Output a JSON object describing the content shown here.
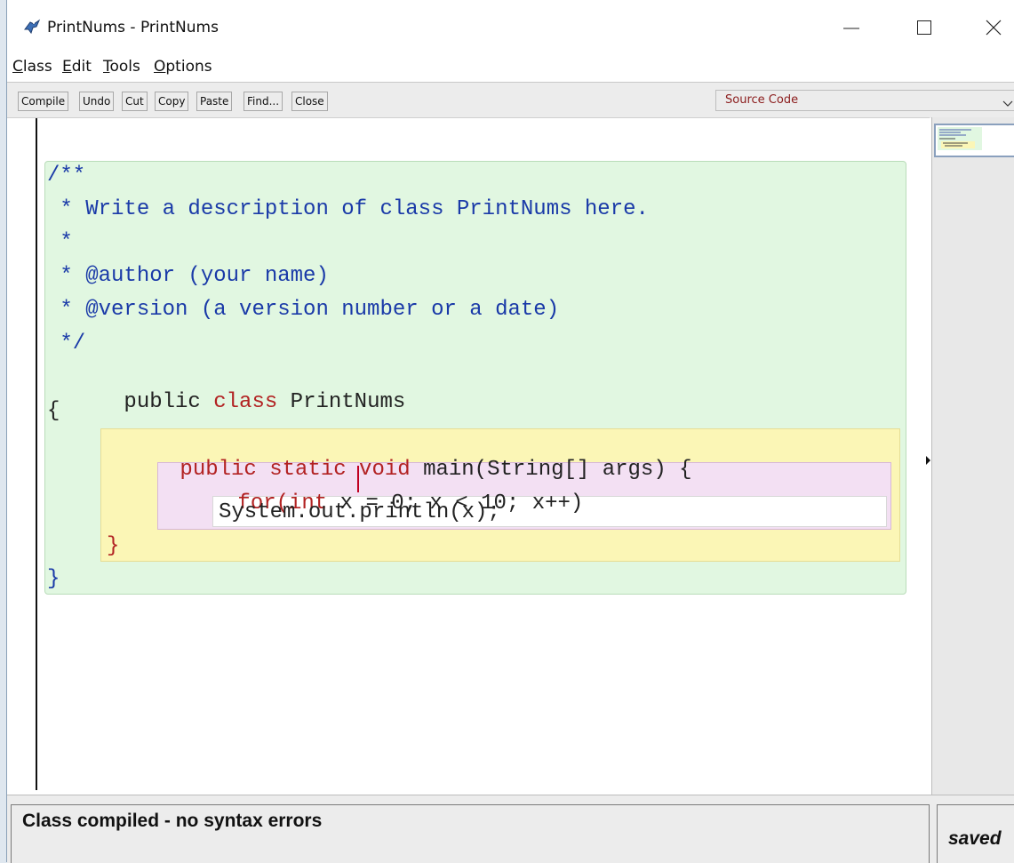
{
  "window": {
    "title": "PrintNums - PrintNums"
  },
  "menu": [
    "Class",
    "Edit",
    "Tools",
    "Options"
  ],
  "toolbar": {
    "buttons": [
      "Compile",
      "Undo",
      "Cut",
      "Copy",
      "Paste",
      "Find...",
      "Close"
    ],
    "view_select": "Source Code"
  },
  "code": {
    "doc": [
      "/**",
      " * Write a description of class PrintNums here.",
      " *",
      " * @author (your name)",
      " * @version (a version number or a date)",
      " */"
    ],
    "class_kw1": "public ",
    "class_kw2": "class",
    "class_name": " PrintNums",
    "open_brace": "{",
    "method_kw": "public static void",
    "method_rest": " main(String[] args) {",
    "for_kw": "for(",
    "for_int": "int",
    "for_rest": " x = 0; x < 10; x++)",
    "body": "System.out.println(x);",
    "method_close": "}",
    "class_close": "}"
  },
  "status": {
    "message": "Class compiled - no syntax errors",
    "saved": "saved"
  },
  "colors": {
    "class_scope": "#e1f7e1",
    "method_scope": "#fbf6b6",
    "loop_scope": "#f3e0f3",
    "comment": "#1a3aa8",
    "keyword": "#b22222"
  },
  "icons": [
    "bluej-bird-icon",
    "minimize-icon",
    "maximize-icon",
    "close-icon",
    "chevron-down-icon"
  ]
}
